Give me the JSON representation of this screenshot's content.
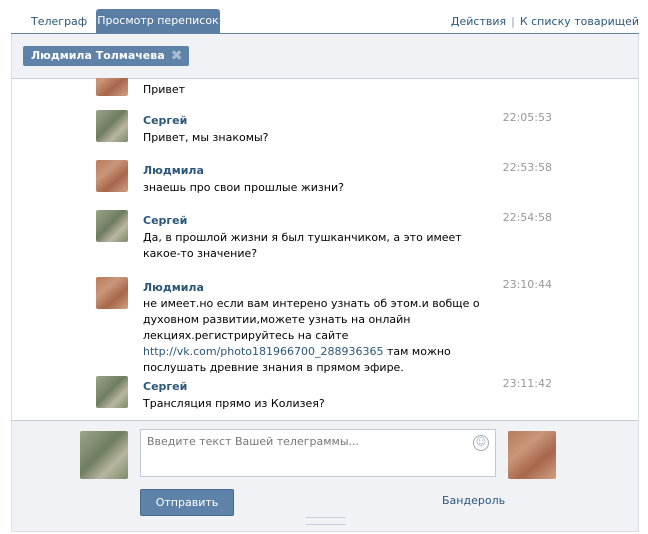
{
  "tabs": [
    "Телеграф",
    "Просмотр переписок"
  ],
  "header_links": {
    "actions": "Действия",
    "separator": "|",
    "friends": "К списку товарищей"
  },
  "chip": {
    "name": "Людмила Толмачева",
    "close": "✖"
  },
  "messages": [
    {
      "author": "",
      "time": "",
      "text": "Привет",
      "avatar": "lyudmila"
    },
    {
      "author": "Сергей",
      "time": "22:05:53",
      "text": "Привет, мы знакомы?",
      "avatar": "sergey"
    },
    {
      "author": "Людмила",
      "time": "22:53:58",
      "text": "знаешь про свои прошлые жизни?",
      "avatar": "lyudmila"
    },
    {
      "author": "Сергей",
      "time": "22:54:58",
      "text": "Да, в прошлой жизни я был тушканчиком, а это имеет какое-то значение?",
      "avatar": "sergey"
    },
    {
      "author": "Людмила",
      "time": "23:10:44",
      "text_before": "не имеет.но если вам интерено узнать об этом.и вобще о духовном развитии,можете узнать на онлайн лекциях.регистрируйтесь на сайте ",
      "link": "http://vk.com/photo181966700_288936365",
      "text_after": " там можно послушать древние знания в прямом эфире.",
      "avatar": "lyudmila"
    },
    {
      "author": "Сергей",
      "time": "23:11:42",
      "text": "Трансляция прямо из Колизея?",
      "avatar": "sergey"
    }
  ],
  "compose": {
    "placeholder": "Введите текст Вашей телеграммы...",
    "send": "Отправить",
    "parcel": "Бандероль",
    "smile_icon": "smiley-icon"
  }
}
